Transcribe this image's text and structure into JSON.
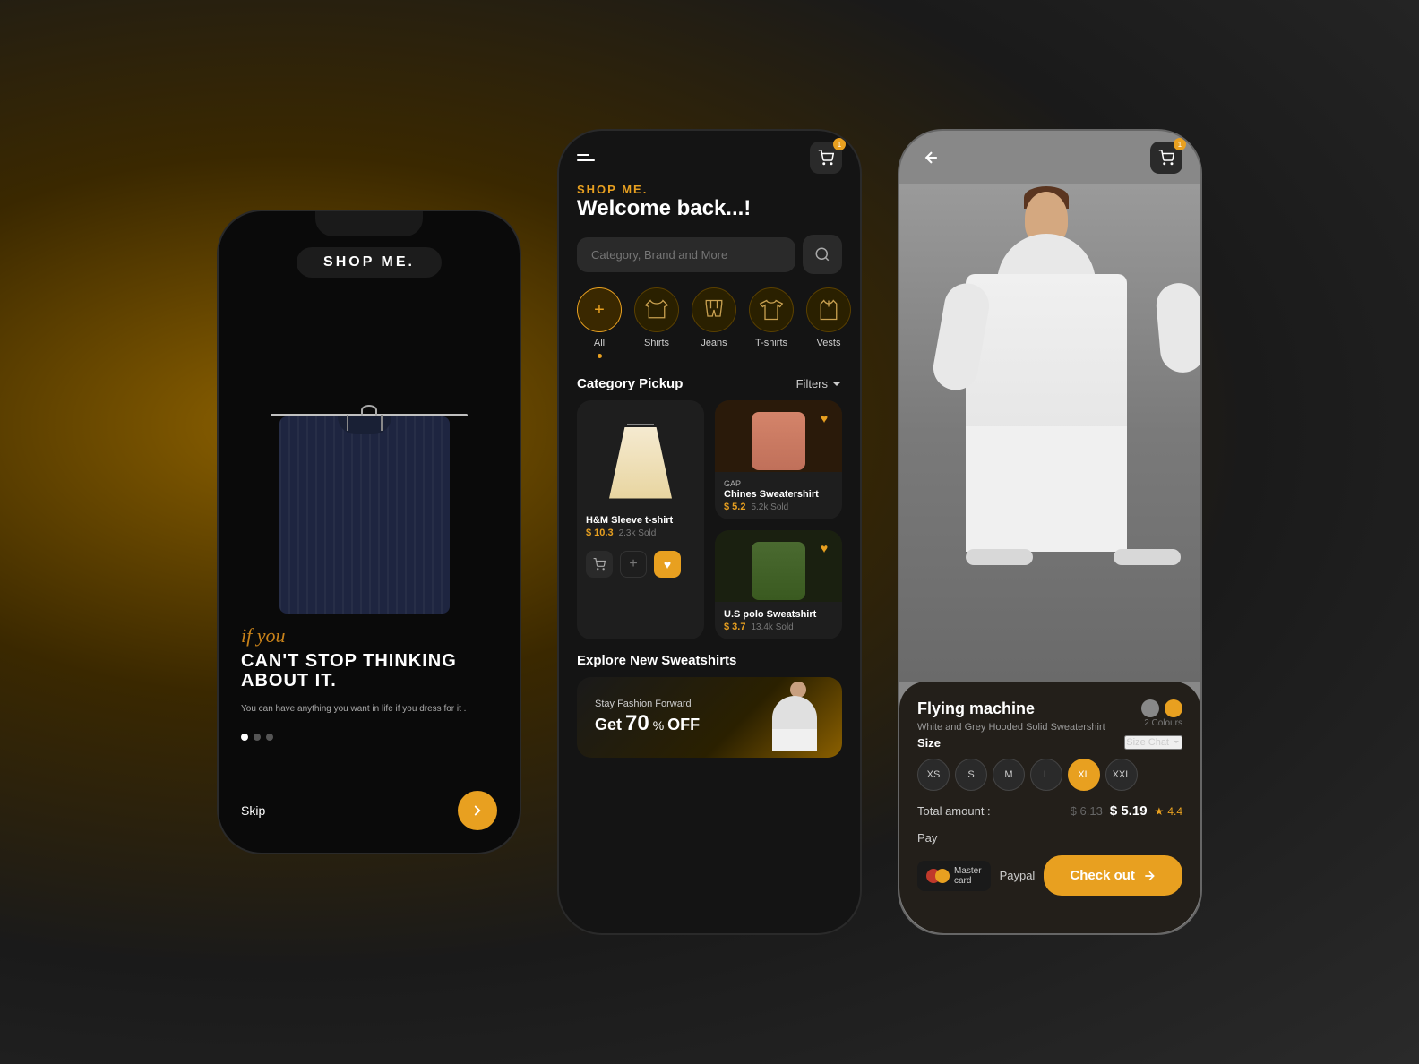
{
  "background": {
    "gradient": "radial-gradient(ellipse at 20% 40%, #8B6000 0%, #3a2800 30%, #1a1a1a 60%, #2a2a2a 100%)"
  },
  "phone1": {
    "title": "SHOP ME.",
    "tagline_italic": "if you",
    "tagline_bold1": "CAN'T STOP THINKING",
    "tagline_bold2": "ABOUT IT.",
    "subtext": "You can have anything you want in life if you dress for it .",
    "skip_label": "Skip",
    "arrow_label": "→"
  },
  "phone2": {
    "shop_label": "SHOP ME.",
    "welcome": "Welcome back...!",
    "search_placeholder": "Category, Brand and More",
    "categories": [
      {
        "label": "All",
        "icon": "+",
        "active": true,
        "dot": true
      },
      {
        "label": "Shirts",
        "icon": "shirt"
      },
      {
        "label": "Jeans",
        "icon": "jeans"
      },
      {
        "label": "T-shirts",
        "icon": "tshirt"
      },
      {
        "label": "Vests",
        "icon": "vest"
      }
    ],
    "section_title": "Category Pickup",
    "filter_label": "Filters",
    "products": [
      {
        "name": "H&M Sleeve t-shirt",
        "price": "$ 10.3",
        "sold": "2.3k Sold",
        "type": "poncho",
        "heart": false
      },
      {
        "brand": "GAP",
        "name": "Chines Sweatershirt",
        "price": "$ 5.2",
        "sold": "5.2k Sold",
        "type": "pink",
        "heart": true
      },
      {
        "name": "U.S polo Sweatshirt",
        "price": "$ 3.7",
        "sold": "13.4k Sold",
        "type": "green",
        "heart": true
      }
    ],
    "explore_title": "Explore New Sweatshirts",
    "promo": {
      "stay_text": "Stay Fashion Forward",
      "get_text": "Get",
      "discount": "70",
      "percent": "%",
      "off": "OFF"
    },
    "cart_count": "1"
  },
  "phone3": {
    "back": "←",
    "cart_count": "1",
    "product": {
      "brand": "Flying machine",
      "description": "White and Grey Hooded Solid Sweatershirt",
      "colours_label": "2 Colours",
      "size_label": "Size",
      "size_chart": "Size Chat",
      "sizes": [
        "XS",
        "S",
        "M",
        "L",
        "XL",
        "XXL"
      ],
      "active_size": "XL",
      "total_label": "Total amount :",
      "original_price": "$ 6.13",
      "current_price": "$ 5.19",
      "rating": "4.4",
      "pay_label": "Pay",
      "mastercard_label": "Master card",
      "paypal_label": "Paypal",
      "checkout_label": "Check out",
      "checkout_arrow": "→"
    }
  }
}
